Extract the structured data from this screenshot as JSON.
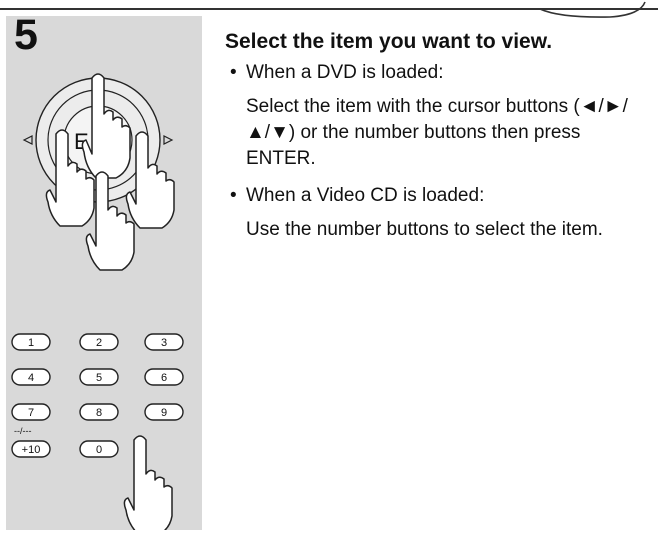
{
  "step": {
    "number": "5"
  },
  "dpad": {
    "center_letter": "E"
  },
  "keypad": {
    "keys": [
      "1",
      "2",
      "3",
      "4",
      "5",
      "6",
      "7",
      "8",
      "9",
      "+10",
      "0"
    ],
    "label_above_plus10": "--/---"
  },
  "content": {
    "heading": "Select the item you want to view.",
    "dvd_bullet": "When a DVD is loaded:",
    "dvd_detail": "Select the item with the cursor buttons (◄/►/▲/▼) or the number buttons then press ENTER.",
    "vcd_bullet": "When a Video CD is loaded:",
    "vcd_detail": "Use the number buttons to select the item."
  },
  "colors": {
    "panel": "#d9d9d9",
    "text": "#111111",
    "line": "#333333"
  },
  "icons": [
    "hand-pointer-icon",
    "direction-pad-icon",
    "triangle-arrow-icon"
  ]
}
